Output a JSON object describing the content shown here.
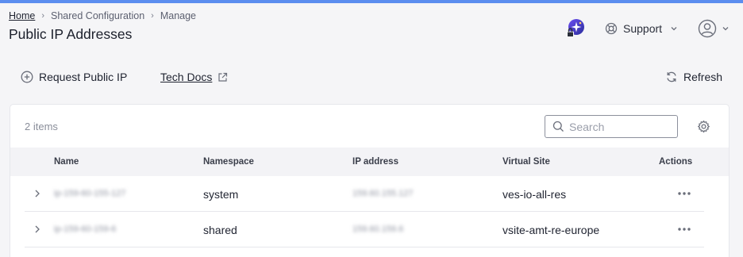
{
  "breadcrumb": {
    "home": "Home",
    "section": "Shared Configuration",
    "page": "Manage"
  },
  "page": {
    "title": "Public IP Addresses"
  },
  "header": {
    "support_label": "Support"
  },
  "toolbar": {
    "request_label": "Request Public IP",
    "docs_label": "Tech Docs",
    "refresh_label": "Refresh"
  },
  "table": {
    "count": "2 items",
    "search_placeholder": "Search",
    "columns": {
      "name": "Name",
      "namespace": "Namespace",
      "ip": "IP address",
      "vsite": "Virtual Site",
      "actions": "Actions"
    },
    "rows": [
      {
        "name": "ip-159-60-155-127",
        "namespace": "system",
        "ip": "159.60.155.127",
        "vsite": "ves-io-all-res"
      },
      {
        "name": "ip-159-60-159-6",
        "namespace": "shared",
        "ip": "159.60.159.6",
        "vsite": "vsite-amt-re-europe"
      }
    ]
  },
  "colors": {
    "accent": "#5b8def",
    "ai_badge": "#3b3fd8"
  }
}
